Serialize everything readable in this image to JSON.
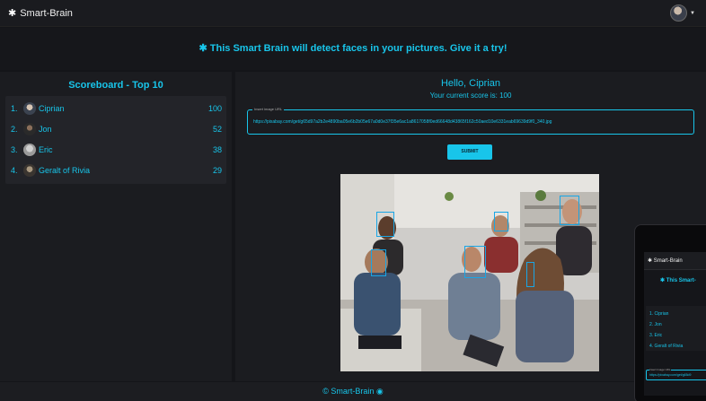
{
  "header": {
    "brand": "Smart-Brain",
    "brand_icon": "brain-icon"
  },
  "banner": {
    "text": "This Smart Brain will detect faces in your pictures. Give it a try!"
  },
  "scoreboard": {
    "title": "Scoreboard - Top 10",
    "rows": [
      {
        "rank": "1.",
        "name": "Ciprian",
        "score": "100"
      },
      {
        "rank": "2.",
        "name": "Jon",
        "score": "52"
      },
      {
        "rank": "3.",
        "name": "Eric",
        "score": "38"
      },
      {
        "rank": "4.",
        "name": "Geralt of Rivia",
        "score": "29"
      }
    ]
  },
  "main": {
    "hello": "Hello, Ciprian",
    "score_line": "Your current score is: 100",
    "url_label": "Insert image URL",
    "url_value": "https://pixabay.com/get/g65d97a2b2e4890ba05e6b2b05e67a0d0e37f35e6ac1a8617058f0ed66648d43865f162c50aed10e6331eab69639d9f0_340.jpg",
    "submit_label": "SUBMIT"
  },
  "footer": {
    "text": "© Smart-Brain",
    "icon": "github-icon"
  },
  "device": {
    "brand": "Smart-Brain",
    "banner": "This Smart-",
    "rows": [
      "1.  Ciprian",
      "2.  Jon",
      "3.  Eric",
      "4.  Geralt of Rivia"
    ],
    "url_label": "Insert Image URL",
    "url_value": "https://pixabay.com/get/g65d9"
  },
  "colors": {
    "accent": "#18c5ea",
    "background": "#141519",
    "panel": "#1b1c20"
  }
}
